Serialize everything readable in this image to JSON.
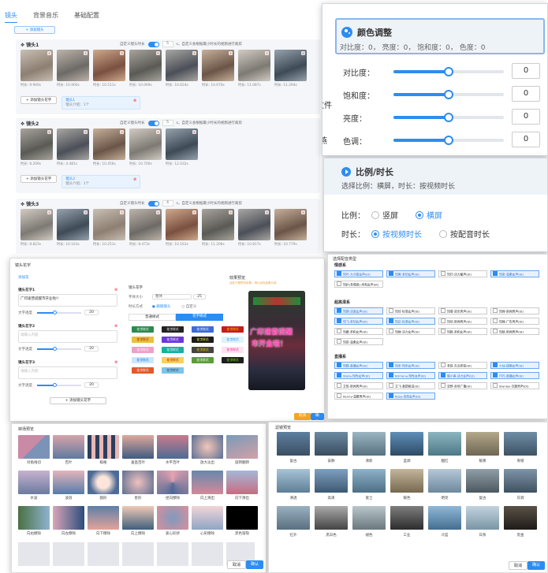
{
  "editor": {
    "tabs": [
      "镜头",
      "背景音乐",
      "基础配置"
    ],
    "add_clip": "+ 添加镜头",
    "custom_duration_label": "自定义镜头时长",
    "duration_unit": "s，自定义会根据最小时长的视频进行裁剪",
    "groups": [
      {
        "title": "镜头1",
        "duration_value": "5",
        "thumbs": [
          "时长: 9.900s",
          "时长: 10.900s",
          "时长: 10.511s",
          "时长: 10.069s",
          "时长: 10.624s",
          "时长: 10.670s",
          "时长: 11.087s",
          "时长: 11.294s"
        ],
        "add_caption": "+ 添加镜头花字",
        "card_title": "镜头1",
        "card_sub": "镜头介绍：1个"
      },
      {
        "title": "镜头2",
        "duration_value": "5",
        "thumbs": [
          "时长: 8.209s",
          "时长: 4.481s",
          "时长: 10.456s",
          "时长: 10.700s",
          "时长: 12.032s"
        ],
        "add_caption": "+ 添加镜头花字",
        "card_title": "镜头2",
        "card_sub": "镜头介绍：1个"
      },
      {
        "title": "镜头3",
        "duration_value": "4",
        "thumbs": [
          "时长: 8.823s",
          "时长: 10.163s",
          "时长: 10.251s",
          "时长: 8.473s",
          "时长: 10.163s",
          "时长: 11.206s",
          "时长: 10.817s",
          "时长: 10.779s"
        ]
      }
    ]
  },
  "color_adjust": {
    "title": "颜色调整",
    "summary": "对比度：0，  亮度：0，  饱和度：0，  色度：0",
    "rows": [
      {
        "label": "对比度：",
        "value": "0",
        "level": 0.5
      },
      {
        "label": "饱和度：",
        "value": "0",
        "level": 0.5
      },
      {
        "label": "亮度：",
        "value": "0",
        "level": 0.5
      },
      {
        "label": "色调：",
        "value": "0",
        "level": 0.5
      }
    ],
    "side_cut_1": "文件",
    "side_cut_2": "燕"
  },
  "ratio": {
    "title": "比例/时长",
    "summary": "选择比例：横屏，时长：按视频时长",
    "ratio_label": "比例：",
    "ratio_options": [
      "竖屏",
      "横屏"
    ],
    "ratio_selected": 1,
    "duration_label": "时长：",
    "duration_options": [
      "按视频时长",
      "按配音时长"
    ],
    "duration_selected": 0
  },
  "caption_editor": {
    "title": "镜头花字",
    "hint": "添加花",
    "items": [
      {
        "label": "镜头花字1",
        "text": "广印速营提醒市开业啦!!",
        "size_label": "文字透度",
        "size": "20"
      },
      {
        "label": "镜头花字2",
        "text": "请输入内容",
        "size_label": "文字透度",
        "size": "20"
      },
      {
        "label": "镜头花字3",
        "text": "请输入内容",
        "size_label": "文字透度",
        "size": "20"
      }
    ],
    "add_btn": "+ 添加镜头花字",
    "style_label": "镜头花字",
    "font_label": "字体大小",
    "font_value": "25",
    "time_label": "时长方式",
    "time_options": [
      "跟随镜头",
      "自定义"
    ],
    "tabs": [
      "普通样式",
      "花字样式"
    ],
    "chip_text": "花字样式",
    "preview_title": "效果预览",
    "preview_note": "此处只是预览效果，请以实际结果为准",
    "preview_text_1": "广印速营提醒",
    "preview_text_2": "市开业啦！",
    "cancel": "取消",
    "ok": "确认"
  },
  "music": {
    "title": "选择配音类型",
    "categories": [
      {
        "name": "情感系",
        "items": [
          "知叶-大众甜女声(bt)",
          "知美-亲切女声(bt)",
          "知归-活力童声(bt)",
          "知柒-温柔女声(bt)",
          "知妙(多情感)-亲和女声(bt)"
        ],
        "selected": [
          0,
          1,
          3
        ]
      },
      {
        "name": "超高清系",
        "items": [
          "知锅-活泼女声(bt)",
          "知佳-标准女声(bt)",
          "知倩-资讯男声(bt)",
          "知禅-新闻男声(bt)",
          "知飞-亲切女声(bt)",
          "知达-标准女声(bt)",
          "知绍-新闻男声(bt)",
          "知楠-广告男声(bt)",
          "知媛-亲和女声(bt)",
          "知婵-活力女声(bt)",
          "知颖-亲和女声(bt)",
          "知硕-新闻男声(bt)",
          "知柒-温柔女声(bt)"
        ],
        "selected": [
          0,
          4,
          5
        ]
      },
      {
        "name": "直播系",
        "items": [
          "知猫-直播女声(bt)",
          "知米-知米女声(bt)",
          "老铁-东北老铁(bt)",
          "小仙-甜美女声(bt)",
          "Stella-知性女声(bt)",
          "Brimena-知性女声(bt)",
          "猫小美-活力女声(bt)",
          "巧巧-直播女声(bt)",
          "艾悦-新闻男声(bt)",
          "艾飞-激昂解说(bt)",
          "亚群-卖场广播(bt)",
          "Stanley-沉稳男声(bt)",
          "Kenny-温暖男声(bt)",
          "Rosa-自然女声(bt)"
        ],
        "selected": [
          0,
          1,
          3,
          4,
          5,
          6,
          7,
          13
        ]
      }
    ],
    "cancel": "取消",
    "ok": "确认"
  },
  "transitions": {
    "title": "转场预览",
    "labels": [
      "对角线切",
      "百叶",
      "棋格",
      "垂直百叶",
      "水平百叶",
      "放大淡出",
      "旋转翻转",
      "水波",
      "波浪",
      "圆形",
      "星形",
      "径向擦除",
      "向上滑出",
      "向下滑出",
      "向右擦除",
      "向左擦除",
      "向下擦除",
      "向上擦除",
      "爱心形状",
      "心形擦除",
      "黑色渐隐"
    ],
    "cancel": "取消",
    "ok": "确认"
  },
  "filters": {
    "title": "滤镜预览",
    "labels": [
      "复古",
      "安静",
      "清新",
      "蓝调",
      "胭红",
      "暖黄",
      "青橙",
      "清透",
      "高清",
      "富士",
      "暖色",
      "明亮",
      "复古",
      "灰调",
      "红外",
      "黑白色",
      "褪色",
      "工业",
      "冷蓝",
      "日系",
      "黑金"
    ],
    "cancel": "取消",
    "ok": "确认"
  }
}
